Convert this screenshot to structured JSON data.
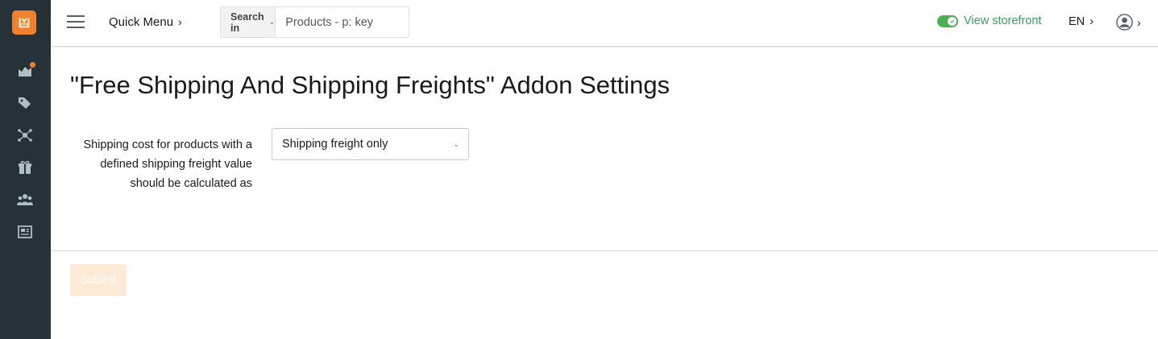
{
  "header": {
    "quick_menu_label": "Quick Menu",
    "chevron": "›",
    "search": {
      "scope_label": "Search in",
      "placeholder": "Products - p: key"
    },
    "storefront_label": "View storefront",
    "language": "EN"
  },
  "sidebar": {
    "items": [
      {
        "icon": "dashboard-icon",
        "has_notification": true
      },
      {
        "icon": "tags-icon"
      },
      {
        "icon": "network-icon"
      },
      {
        "icon": "gift-icon"
      },
      {
        "icon": "users-icon"
      },
      {
        "icon": "news-icon"
      }
    ]
  },
  "main": {
    "title": "\"Free Shipping And Shipping Freights\" Addon Settings",
    "field": {
      "label": "Shipping cost for products with a defined shipping freight value should be calculated as",
      "selected_value": "Shipping freight only"
    },
    "submit_label": "Submit"
  },
  "colors": {
    "sidebar_bg": "#263238",
    "accent": "#f0822d",
    "storefront_green": "#3c9b5a",
    "toggle_green": "#4caf50",
    "submit_disabled_bg": "#fdebd8"
  }
}
